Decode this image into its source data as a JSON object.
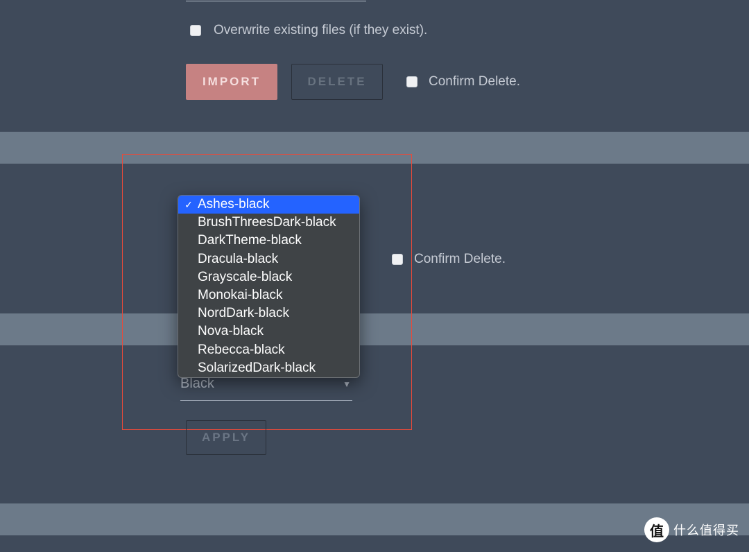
{
  "top": {
    "overwrite_label": "Overwrite existing files (if they exist).",
    "import_label": "IMPORT",
    "delete_label": "DELETE",
    "confirm_delete_label": "Confirm Delete."
  },
  "mid": {
    "confirm_delete_label": "Confirm Delete."
  },
  "dropdown": {
    "selected_index": 0,
    "items": [
      "Ashes-black",
      "BrushThreesDark-black",
      "DarkTheme-black",
      "Dracula-black",
      "Grayscale-black",
      "Monokai-black",
      "NordDark-black",
      "Nova-black",
      "Rebecca-black",
      "SolarizedDark-black"
    ]
  },
  "lower_select": {
    "value": "Black"
  },
  "apply_label": "APPLY",
  "brand": {
    "glyph": "值",
    "text": "什么值得买"
  }
}
